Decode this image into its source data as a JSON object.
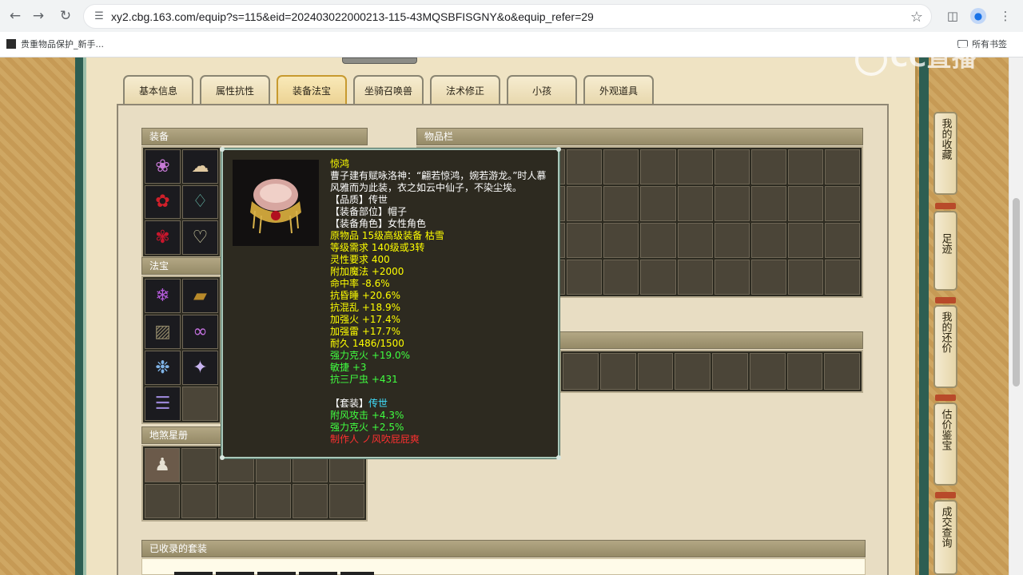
{
  "browser": {
    "url": "xy2.cbg.163.com/equip?s=115&eid=202403022000213-115-43MQSBFISGNY&o&equip_refer=29",
    "bookmark": "贵重物品保护_新手...",
    "all_bookmarks": "所有书签"
  },
  "watermark": "CC直播",
  "tabs": [
    "基本信息",
    "属性抗性",
    "装备法宝",
    "坐骑召唤兽",
    "法术修正",
    "小孩",
    "外观道具"
  ],
  "active_tab": "装备法宝",
  "sections": {
    "equipment": "装备",
    "inventory": "物品栏",
    "fabao": "法宝",
    "dishaxingce": "地煞星册",
    "collected_sets": "已收录的套装"
  },
  "tooltip": {
    "name": "惊鸿",
    "description": "曹子建有赋咏洛神：“翩若惊鸿，婉若游龙。”时人慕风雅而为此装，衣之如云中仙子，不染尘埃。",
    "quality": "【品质】传世",
    "slot": "【装备部位】帽子",
    "role": "【装备角色】女性角色",
    "origin": "原物品 15级高级装备 枯雪",
    "level_req": "等级需求 140级或3转",
    "spirit_req": "灵性要求 400",
    "stats": [
      "附加魔法 +2000",
      "命中率 -8.6%",
      "抗昏睡 +20.6%",
      "抗混乱 +18.9%",
      "加强火 +17.4%",
      "加强雷 +17.7%",
      "耐久 1486/1500"
    ],
    "green_stats": [
      "强力克火 +19.0%",
      "敏捷 +3",
      "抗三尸虫 +431"
    ],
    "set_label": "【套装】",
    "set_name": "传世",
    "set_stats": [
      "附风攻击 +4.3%",
      "强力克火 +2.5%"
    ],
    "maker": "制作人 ノ风吹屁屁爽"
  },
  "sidebar": [
    "我的收藏",
    "足迹",
    "我的还价",
    "估价鉴宝",
    "成交查询"
  ],
  "colors": {
    "rail": "#2d5e52",
    "tooltip_bg": "#2d2a20",
    "name_yellow": "#ffff00",
    "stat_green": "#40ff40",
    "set_cyan": "#40e0ff",
    "maker_red": "#ff3030"
  }
}
